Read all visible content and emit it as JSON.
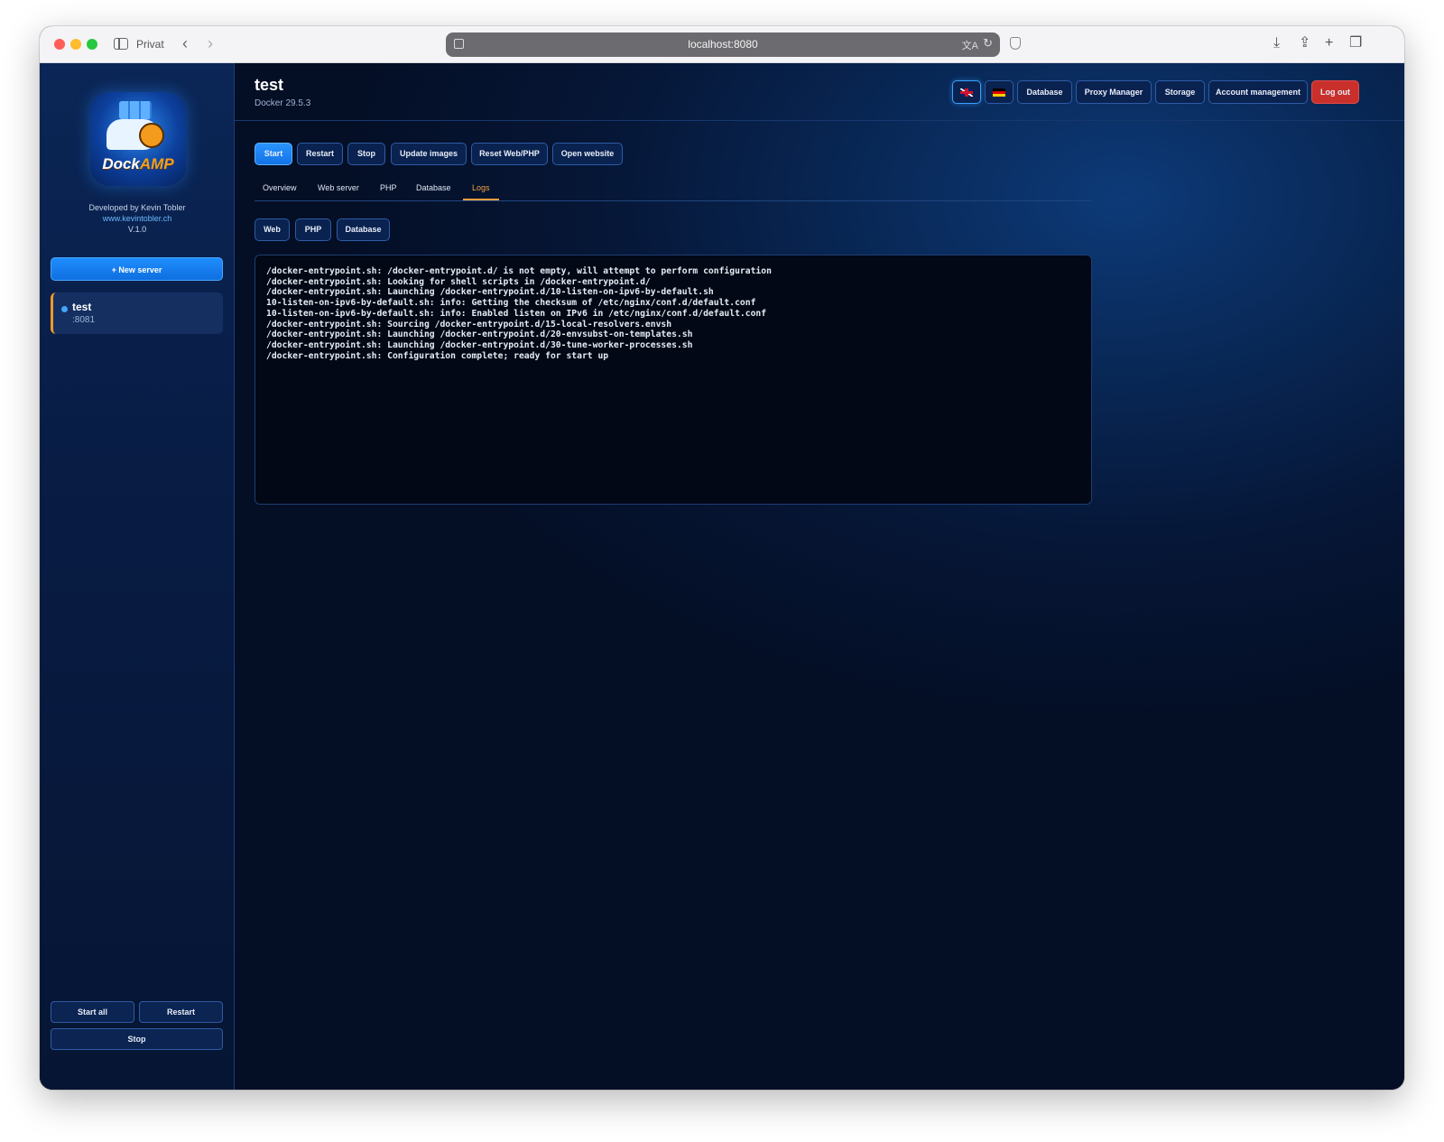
{
  "browser": {
    "profile": "Privat",
    "url": "localhost:8080"
  },
  "sidebar": {
    "logo_text_a": "Dock",
    "logo_text_b": "AMP",
    "developed_by": "Developed by Kevin Tobler",
    "website": "www.kevintobler.ch",
    "version": "V.1.0",
    "new_server": "+ New server",
    "servers": [
      {
        "name": "test",
        "port": ":8081"
      }
    ],
    "start_all": "Start all",
    "restart": "Restart",
    "stop": "Stop"
  },
  "header": {
    "title": "test",
    "docker_version": "Docker 29.5.3",
    "buttons": {
      "database": "Database",
      "proxy_manager": "Proxy Manager",
      "storage": "Storage",
      "account_management": "Account management",
      "logout": "Log out"
    }
  },
  "actions": {
    "start": "Start",
    "restart": "Restart",
    "stop": "Stop",
    "update_images": "Update images",
    "reset_web_php": "Reset Web/PHP",
    "open_website": "Open website"
  },
  "tabs": {
    "overview": "Overview",
    "web_server": "Web server",
    "php": "PHP",
    "database": "Database",
    "logs": "Logs"
  },
  "log_sources": {
    "web": "Web",
    "php": "PHP",
    "database": "Database"
  },
  "logs": [
    "/docker-entrypoint.sh: /docker-entrypoint.d/ is not empty, will attempt to perform configuration",
    "/docker-entrypoint.sh: Looking for shell scripts in /docker-entrypoint.d/",
    "/docker-entrypoint.sh: Launching /docker-entrypoint.d/10-listen-on-ipv6-by-default.sh",
    "10-listen-on-ipv6-by-default.sh: info: Getting the checksum of /etc/nginx/conf.d/default.conf",
    "10-listen-on-ipv6-by-default.sh: info: Enabled listen on IPv6 in /etc/nginx/conf.d/default.conf",
    "/docker-entrypoint.sh: Sourcing /docker-entrypoint.d/15-local-resolvers.envsh",
    "/docker-entrypoint.sh: Launching /docker-entrypoint.d/20-envsubst-on-templates.sh",
    "/docker-entrypoint.sh: Launching /docker-entrypoint.d/30-tune-worker-processes.sh",
    "/docker-entrypoint.sh: Configuration complete; ready for start up"
  ]
}
